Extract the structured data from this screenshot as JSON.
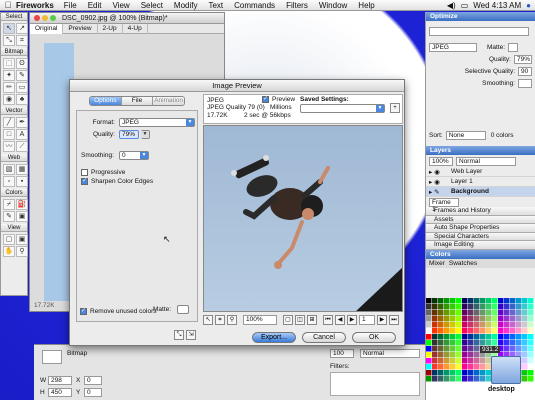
{
  "menubar": {
    "app": "Fireworks",
    "items": [
      "File",
      "Edit",
      "View",
      "Select",
      "Modify",
      "Text",
      "Commands",
      "Filters",
      "Window",
      "Help"
    ],
    "clock": "Wed 4:13 AM"
  },
  "tools": {
    "sections": [
      "Select",
      "Bitmap",
      "Vector",
      "Web",
      "Colors",
      "View"
    ]
  },
  "document": {
    "title": "DSC_0902.jpg @ 100% (Bitmap)*",
    "tabs": [
      "Original",
      "Preview",
      "2-Up",
      "4-Up"
    ],
    "status": "17.72K"
  },
  "optimize": {
    "header": "Optimize",
    "format": "JPEG",
    "matte_label": "Matte:",
    "quality_label": "Quality:",
    "quality_value": "79%",
    "selective_label": "Selective Quality:",
    "selective_value": "90",
    "smoothing_label": "Smoothing:",
    "sort_label": "Sort:",
    "sort_value": "None",
    "colors_count": "0 colors"
  },
  "layers": {
    "header": "Layers",
    "opacity": "100%",
    "blend": "Normal",
    "rows": [
      "Web Layer",
      "Layer 1",
      "Background"
    ],
    "frame_label": "Frame 1"
  },
  "collapsed_panels": [
    "Frames and History",
    "Assets",
    "Auto Shape Properties",
    "Special Characters",
    "Image Editing"
  ],
  "colors_panel": {
    "header": "Colors",
    "tabs": [
      "Mixer",
      "Swatches"
    ]
  },
  "swatch_colors": [
    "#000000",
    "#333333",
    "#666666",
    "#999999",
    "#cccccc",
    "#ffffff",
    "#ff0000",
    "#00ff00",
    "#0000ff",
    "#ffff00",
    "#ff00ff",
    "#00ffff",
    "#990000",
    "#009900",
    "#000099",
    "#999900",
    "#990099",
    "#009999",
    "#ff9900",
    "#99ff00",
    "#0099ff",
    "#ff0099",
    "#cc3300",
    "#33cc00",
    "#0033cc",
    "#cc0033",
    "#ffcc00",
    "#00ffcc",
    "#cc00ff",
    "#663300",
    "#336600",
    "#003366",
    "#660033"
  ],
  "property_inspector": {
    "kind": "Bitmap",
    "w_label": "W",
    "w_value": "298",
    "h_label": "H",
    "h_value": "450",
    "x_label": "X",
    "x_value": "0",
    "y_label": "Y",
    "y_value": "0",
    "opacity": "100",
    "blend": "Normal",
    "filters_label": "Filters:"
  },
  "desktop": {
    "disk_size": "931.2",
    "icon_label": "desktop"
  },
  "dialog": {
    "title": "Image Preview",
    "tabs": [
      "Options",
      "File",
      "Animation"
    ],
    "format_label": "Format:",
    "format_value": "JPEG",
    "quality_label": "Quality:",
    "quality_value": "79%",
    "smoothing_label": "Smoothing:",
    "smoothing_value": "0",
    "progressive_label": "Progressive",
    "sharpen_label": "Sharpen Color Edges",
    "matte_label": "Matte:",
    "remove_unused_label": "Remove unused colors",
    "info_format": "JPEG",
    "info_quality": "JPEG Quality 79 (0)",
    "info_size": "17.72K",
    "info_time": "2 sec @ 56kbps",
    "preview_checkbox": "Preview",
    "millions": "Millions",
    "saved_settings_label": "Saved Settings:",
    "zoom": "100%",
    "frame_number": "1",
    "export_button": "Export...",
    "cancel_button": "Cancel",
    "ok_button": "OK"
  }
}
